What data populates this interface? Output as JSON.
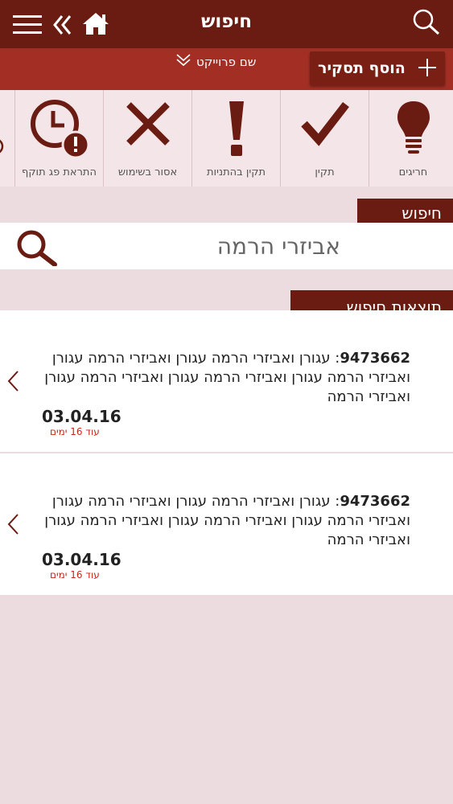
{
  "header": {
    "title": "חיפוש",
    "project_name": "שם פרוייקט",
    "add_report": "הוסף תסקיר"
  },
  "categories": [
    {
      "label": "חריגים",
      "icon": "lightbulb-icon"
    },
    {
      "label": "תקין",
      "icon": "checkmark-icon"
    },
    {
      "label": "תקין בהתניות",
      "icon": "exclamation-icon"
    },
    {
      "label": "אסור בשימוש",
      "icon": "x-icon"
    },
    {
      "label": "התראת פג תוקף",
      "icon": "clock-alert-icon"
    }
  ],
  "search": {
    "section_title": "חיפוש",
    "value": "אביזרי הרמה",
    "placeholder": "אביזרי הרמה"
  },
  "results": {
    "section_title": "תוצאות חיפוש",
    "items": [
      {
        "id": "9473662",
        "separator": ": ",
        "text": "עגורן ואביזרי הרמה  עגורן ואביזרי הרמה עגורן ואביזרי הרמה עגורן ואביזרי הרמה עגורן ואביזרי הרמה עגורן ואביזרי הרמה",
        "date": "03.04.16",
        "remaining": "עוד 16 ימים"
      },
      {
        "id": "9473662",
        "separator": ": ",
        "text": "עגורן ואביזרי הרמה  עגורן ואביזרי הרמה עגורן ואביזרי הרמה עגורן ואביזרי הרמה עגורן ואביזרי הרמה עגורן ואביזרי הרמה",
        "date": "03.04.16",
        "remaining": "עוד 16 ימים"
      }
    ]
  },
  "colors": {
    "header": "#6b1c12",
    "project_bar": "#a32f24",
    "accent_red": "#c8261b",
    "background": "#eddcdf"
  }
}
